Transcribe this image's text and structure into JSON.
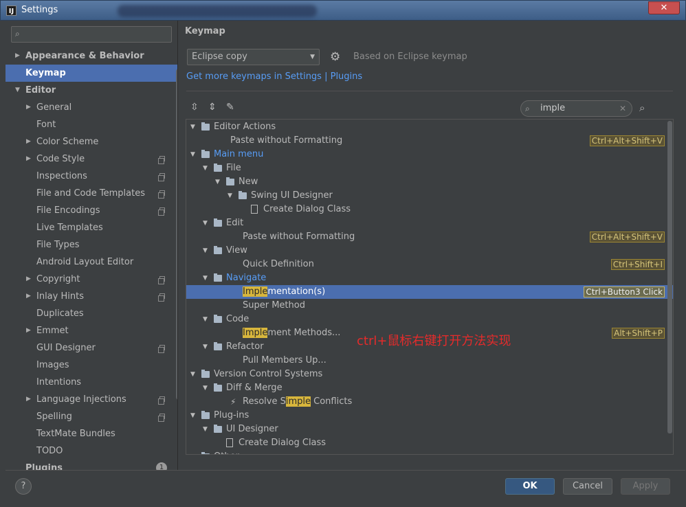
{
  "window": {
    "app_icon": "IJ",
    "title": "Settings",
    "close_label": "✕"
  },
  "sidebar": {
    "search_placeholder": "",
    "items": [
      {
        "label": "Appearance & Behavior",
        "level": 0,
        "bold": true,
        "arrow": "▶"
      },
      {
        "label": "Keymap",
        "level": 0,
        "bold": true,
        "selected": true
      },
      {
        "label": "Editor",
        "level": 0,
        "bold": true,
        "arrow": "▼"
      },
      {
        "label": "General",
        "level": 1,
        "arrow": "▶"
      },
      {
        "label": "Font",
        "level": 1
      },
      {
        "label": "Color Scheme",
        "level": 1,
        "arrow": "▶"
      },
      {
        "label": "Code Style",
        "level": 1,
        "arrow": "▶",
        "copy_icon": true
      },
      {
        "label": "Inspections",
        "level": 1,
        "copy_icon": true
      },
      {
        "label": "File and Code Templates",
        "level": 1,
        "copy_icon": true
      },
      {
        "label": "File Encodings",
        "level": 1,
        "copy_icon": true
      },
      {
        "label": "Live Templates",
        "level": 1
      },
      {
        "label": "File Types",
        "level": 1
      },
      {
        "label": "Android Layout Editor",
        "level": 1
      },
      {
        "label": "Copyright",
        "level": 1,
        "arrow": "▶",
        "copy_icon": true
      },
      {
        "label": "Inlay Hints",
        "level": 1,
        "arrow": "▶",
        "copy_icon": true
      },
      {
        "label": "Duplicates",
        "level": 1
      },
      {
        "label": "Emmet",
        "level": 1,
        "arrow": "▶"
      },
      {
        "label": "GUI Designer",
        "level": 1,
        "copy_icon": true
      },
      {
        "label": "Images",
        "level": 1
      },
      {
        "label": "Intentions",
        "level": 1
      },
      {
        "label": "Language Injections",
        "level": 1,
        "arrow": "▶",
        "copy_icon": true
      },
      {
        "label": "Spelling",
        "level": 1,
        "copy_icon": true
      },
      {
        "label": "TextMate Bundles",
        "level": 1
      },
      {
        "label": "TODO",
        "level": 1
      },
      {
        "label": "Plugins",
        "level": 0,
        "bold": true,
        "badge": "1"
      }
    ]
  },
  "main": {
    "heading": "Keymap",
    "keymap_select": "Eclipse copy",
    "based_on": "Based on Eclipse keymap",
    "more_link": "Get more keymaps in Settings | Plugins",
    "filter_value": "imple",
    "annotation": "ctrl+鼠标右键打开方法实现"
  },
  "tree": [
    {
      "depth": 0,
      "expand": "▼",
      "icon": "folder",
      "label": "Editor Actions"
    },
    {
      "depth": 1,
      "label": "Paste without Formatting",
      "shortcut": "Ctrl+Alt+Shift+V"
    },
    {
      "depth": 0,
      "expand": "▼",
      "icon": "folder",
      "label": "Main menu",
      "blue": true
    },
    {
      "depth": 1,
      "expand": "▼",
      "icon": "folder",
      "label": "File"
    },
    {
      "depth": 2,
      "expand": "▼",
      "icon": "folder",
      "label": "New"
    },
    {
      "depth": 3,
      "expand": "▼",
      "icon": "folder",
      "label": "Swing UI Designer"
    },
    {
      "depth": 4,
      "icon": "doc",
      "label": "Create Dialog Class"
    },
    {
      "depth": 1,
      "expand": "▼",
      "icon": "folder",
      "label": "Edit"
    },
    {
      "depth": 2,
      "label": "Paste without Formatting",
      "shortcut": "Ctrl+Alt+Shift+V"
    },
    {
      "depth": 1,
      "expand": "▼",
      "icon": "folder",
      "label": "View"
    },
    {
      "depth": 2,
      "label": "Quick Definition",
      "shortcut": "Ctrl+Shift+I"
    },
    {
      "depth": 1,
      "expand": "▼",
      "icon": "folder",
      "label": "Navigate",
      "blue": true
    },
    {
      "depth": 2,
      "pre": "",
      "hl": "Imple",
      "post": "mentation(s)",
      "shortcut": "Ctrl+Button3 Click",
      "selected": true
    },
    {
      "depth": 2,
      "label": "Super Method"
    },
    {
      "depth": 1,
      "expand": "▼",
      "icon": "folder",
      "label": "Code"
    },
    {
      "depth": 2,
      "pre": "",
      "hl": "Imple",
      "post": "ment Methods...",
      "shortcut": "Alt+Shift+P"
    },
    {
      "depth": 1,
      "expand": "▼",
      "icon": "folder",
      "label": "Refactor"
    },
    {
      "depth": 2,
      "label": "Pull Members Up..."
    },
    {
      "depth": 0,
      "expand": "▼",
      "icon": "folder",
      "label": "Version Control Systems"
    },
    {
      "depth": 1,
      "expand": "▼",
      "icon": "folder",
      "label": "Diff & Merge"
    },
    {
      "depth": 2,
      "icon": "wand",
      "pre": "Resolve S",
      "hl": "imple",
      "post": " Conflicts"
    },
    {
      "depth": 0,
      "expand": "▼",
      "icon": "folder",
      "label": "Plug-ins"
    },
    {
      "depth": 1,
      "expand": "▼",
      "icon": "folder",
      "label": "UI Designer"
    },
    {
      "depth": 2,
      "icon": "doc",
      "label": "Create Dialog Class"
    },
    {
      "depth": 0,
      "expand": "▶",
      "icon": "folder",
      "label": "Other"
    }
  ],
  "buttons": {
    "help": "?",
    "ok": "OK",
    "cancel": "Cancel",
    "apply": "Apply"
  },
  "colors": {
    "selection": "#4b6eaf",
    "link": "#589df6",
    "highlight": "#d8b63c",
    "annotation": "#e52b2b"
  }
}
